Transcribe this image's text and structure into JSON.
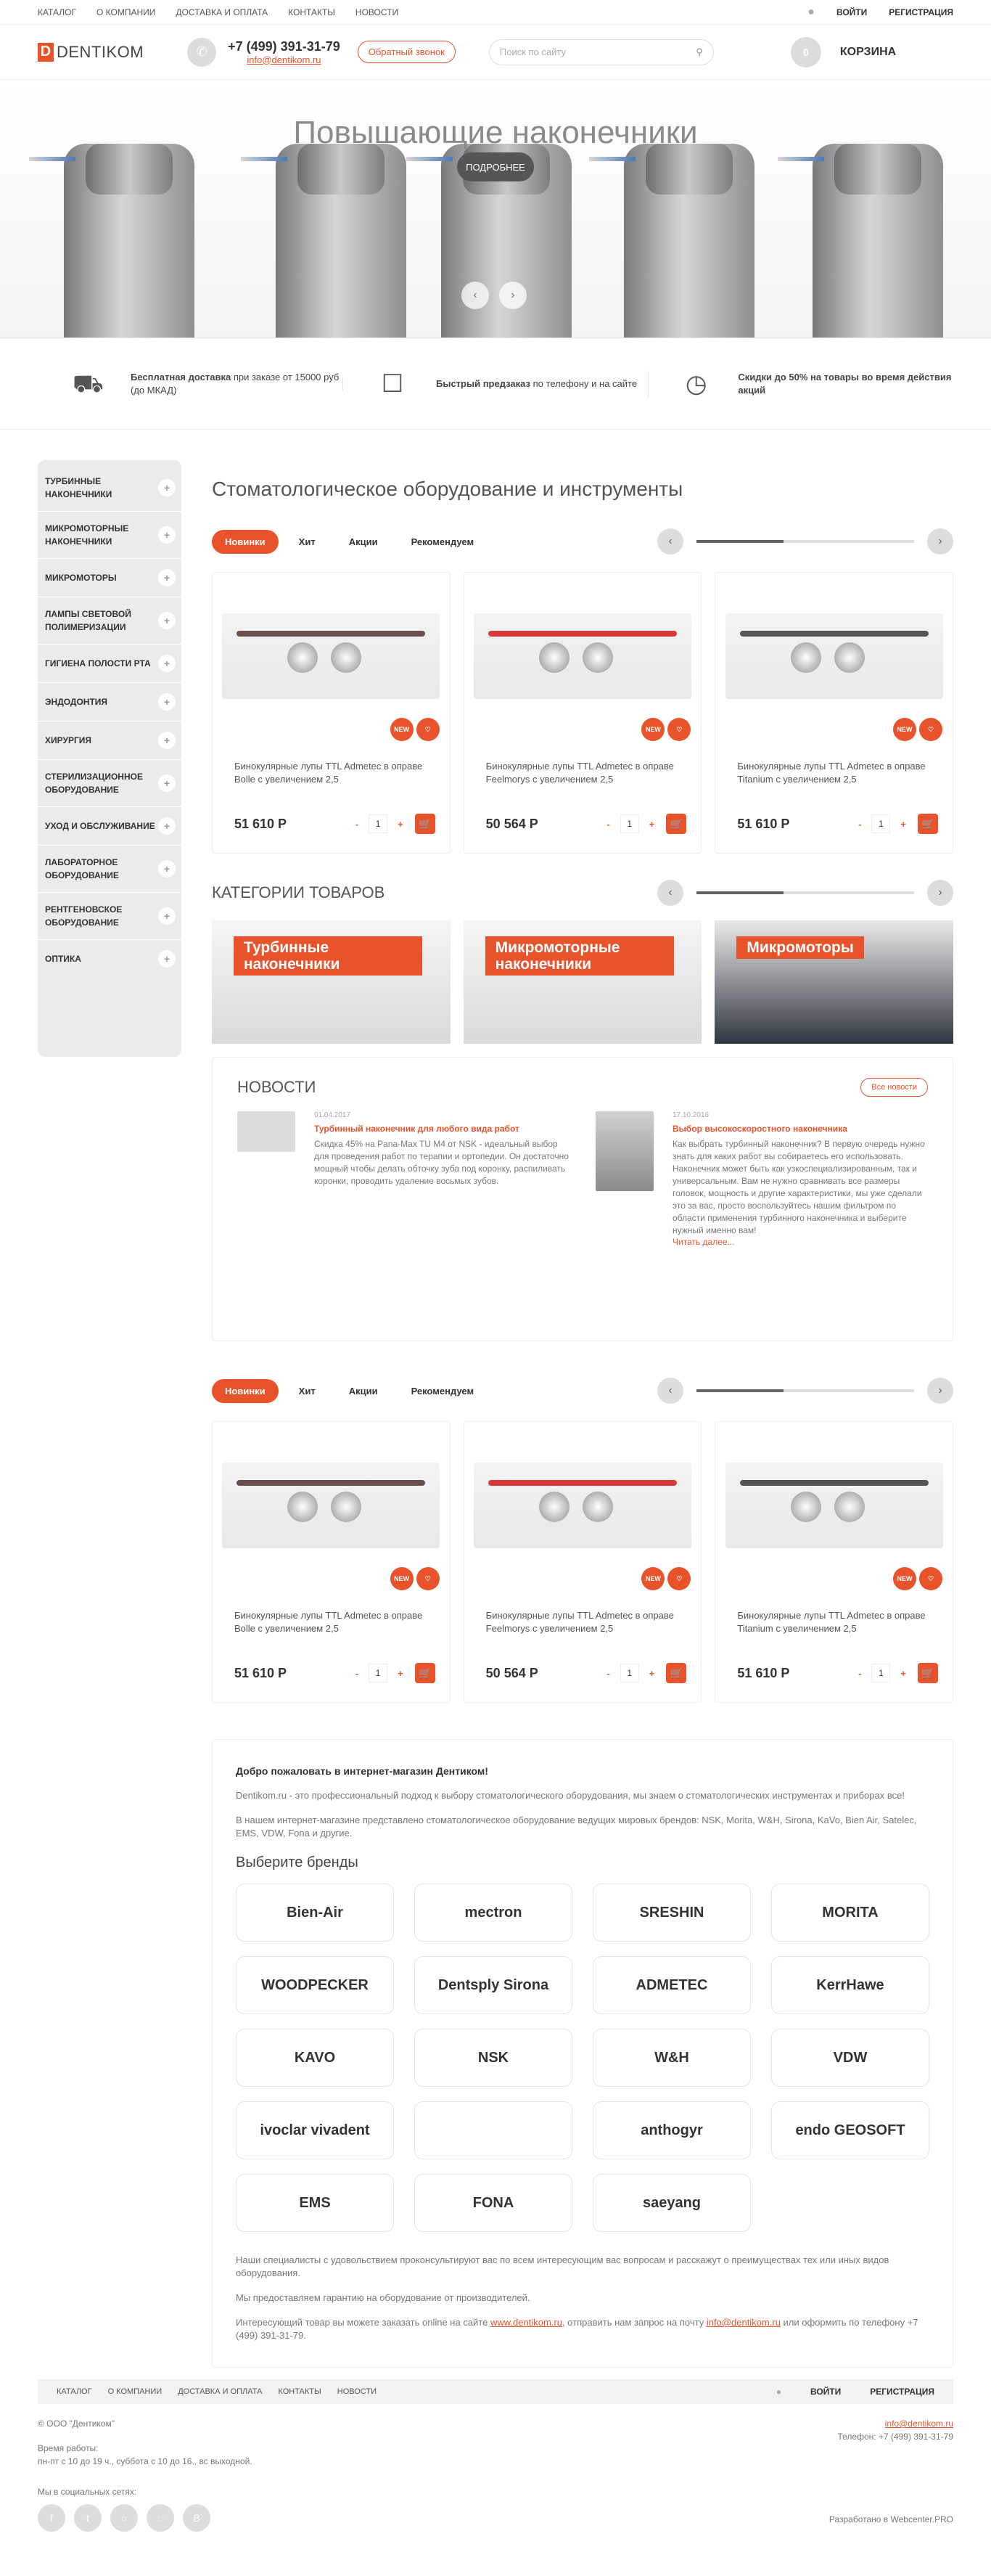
{
  "topbar": {
    "nav": [
      "Каталог",
      "О компании",
      "Доставка и оплата",
      "Контакты",
      "Новости"
    ],
    "login": "Войти",
    "register": "Регистрация"
  },
  "header": {
    "logo": "DENTIKOM",
    "logo_letter": "D",
    "phone": "+7 (499) 391-31-79",
    "email": "info@dentikom.ru",
    "callback": "Обратный звонок",
    "search_placeholder": "Поиск по сайту",
    "cart": "КОРЗИНА"
  },
  "hero": {
    "title": "Повышающие наконечники",
    "button": "ПОДРОБНЕЕ"
  },
  "features": [
    {
      "bold": "Бесплатная доставка",
      "text": "при заказе от 15000 руб (до МКАД)"
    },
    {
      "bold": "Быстрый предзаказ",
      "text": "по телефону и на сайте"
    },
    {
      "bold": "Скидки до 50% на товары во время действия акций",
      "text": ""
    }
  ],
  "sidebar": [
    "Турбинные наконечники",
    "Микромоторные наконечники",
    "Микромоторы",
    "Лампы световой полимеризации",
    "Гигиена полости рта",
    "Эндодонтия",
    "Хирургия",
    "Стерилизационное оборудование",
    "Уход и обслуживание",
    "Лабораторное оборудование",
    "Рентгеновское оборудование",
    "Оптика"
  ],
  "page_title": "Стоматологическое оборудование и инструменты",
  "tabs": [
    "Новинки",
    "Хит",
    "Акции",
    "Рекомендуем"
  ],
  "products": [
    {
      "name": "Бинокулярные лупы TTL Admetec в оправе Bolle с увеличением 2,5",
      "price": "51 610 Р",
      "qty": "1",
      "frame_color": "#6b4f4f",
      "badge": "NEW"
    },
    {
      "name": "Бинокулярные лупы TTL Admetec в оправе Feelmorys с увеличением 2,5",
      "price": "50 564 Р",
      "qty": "1",
      "frame_color": "#d83a3a",
      "badge": "NEW"
    },
    {
      "name": "Бинокулярные лупы TTL Admetec в оправе Titanium с увеличением 2,5",
      "price": "51 610 Р",
      "qty": "1",
      "frame_color": "#555555",
      "badge": "NEW"
    }
  ],
  "categories_title": "Категории товаров",
  "categories": [
    "Турбинные наконечники",
    "Микромоторные наконечники",
    "Микромоторы"
  ],
  "news": {
    "title": "Новости",
    "all": "Все новости",
    "items": [
      {
        "date": "01.04.2017",
        "title": "Турбинный наконечник для любого вида работ",
        "text": "Скидка 45% на Pana-Max TU M4 от NSK - идеальный выбор для проведения работ по терапии и ортопедии. Он достаточно мощный чтобы делать обточку зуба под коронку, распиливать коронки, проводить удаление восьмых зубов.",
        "more": ""
      },
      {
        "date": "17.10.2016",
        "title": "Выбор высокоскоростного наконечника",
        "text": "Как выбрать турбинный наконечник? В первую очередь нужно знать для каких работ вы собираетесь его использовать. Наконечник может быть как узкоспециализированным, так и универсальным. Вам не нужно сравнивать все размеры головок, мощность и другие характеристики, мы уже сделали это за вас, просто воспользуйтесь нашим фильтром по области применения турбинного наконечника и выберите нужный именно вам!",
        "more": "Читать далее..."
      }
    ]
  },
  "about": {
    "welcome": "Добро пожаловать в интернет-магазин Дентиком!",
    "p1": "Dentikom.ru - это профессиональный подход к выбору стоматологического оборудования, мы знаем о стоматологических инструментах и приборах все!",
    "p2": "В нашем интернет-магазине представлено стоматологическое оборудование ведущих мировых брендов: NSK, Morita, W&H, Sirona, KaVo, Bien Air, Satelec, EMS, VDW, Fona и другие.",
    "brands_title": "Выберите бренды",
    "brands": [
      "Bien-Air",
      "mectron",
      "SRESHIN",
      "MORITA",
      "WOODPECKER",
      "Dentsply Sirona",
      "ADMETEC",
      "KerrHawe",
      "KAVO",
      "NSK",
      "W&H",
      "VDW",
      "ivoclar vivadent",
      "",
      "anthogyr",
      "endo GEOSOFT",
      "EMS",
      "FONA",
      "saeyang"
    ],
    "p3": "Наши специалисты с удовольствием проконсультируют вас по всем интересующим вас вопросам и расскажут о преимуществах тех или иных видов оборудования.",
    "p4": "Мы предоставляем гарантию на оборудование от производителей.",
    "p5_a": "Интересующий товар вы можете заказать online на сайте ",
    "p5_site": "www.dentikom.ru",
    "p5_b": ", отправить нам запрос на почту ",
    "p5_mail": "info@dentikom.ru",
    "p5_c": " или оформить по телефону +7 (499) 391-31-79."
  },
  "footer": {
    "nav": [
      "Каталог",
      "О компании",
      "Доставка и оплата",
      "Контакты",
      "Новости"
    ],
    "login": "Войти",
    "register": "Регистрация",
    "copyright": "© ООО \"Дентиком\"",
    "hours_label": "Время работы:",
    "hours": "пн-пт с 10 до 19 ч., суббота с 10 до 16., вс выходной.",
    "social_label": "Мы в социальных сетях:",
    "email": "info@dentikom.ru",
    "phone": "Телефон: +7 (499) 391-31-79",
    "dev": "Разработано в Webcenter.PRO"
  }
}
